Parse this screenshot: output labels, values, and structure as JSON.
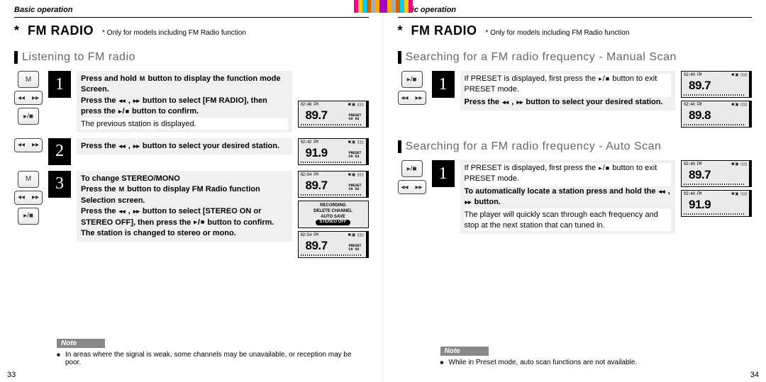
{
  "header": "Basic operation",
  "feature": {
    "asterisk": "*",
    "title": "FM RADIO",
    "subtitle": "* Only for models including FM Radio function"
  },
  "left": {
    "section1": "Listening to FM radio",
    "step1": {
      "num": "1",
      "text_a": "Press and hold ",
      "btn_m": "M",
      "text_b": " button to display the function mode Screen.",
      "text_c": "Press the ",
      "text_d": " button to select [FM RADIO], then press the ",
      "text_e": " button to confirm.",
      "subtext": "The previous station is displayed.",
      "lcd": {
        "time": "02:40 FM",
        "bat": "■■■■",
        "freq": "89.7",
        "preset": "PRESET",
        "ch": "CH 02"
      }
    },
    "step2": {
      "num": "2",
      "text_a": "Press the ",
      "text_b": " button to select your desired station.",
      "lcd": {
        "time": "02:42 FM",
        "freq": "91.9",
        "preset": "PRESET",
        "ch": "CH 03"
      }
    },
    "step3": {
      "num": "3",
      "title": "To change STEREO/MONO",
      "text_a": "Press the ",
      "btn_m": "M",
      "text_b": " button to display FM Radio function Selection screen.",
      "text_c": "Press the ",
      "text_d": " button to select [STEREO ON or STEREO OFF], then press the ",
      "text_e": " button to confirm.",
      "text_f": "The station is changed to stereo or mono.",
      "lcd1": {
        "time": "02:54 FM",
        "freq": "89.7",
        "preset": "PRESET",
        "ch": "CH 02"
      },
      "menu": {
        "l1": "RECORDING",
        "l2": "DELETE CHANNEL",
        "l3": "AUTO SAVE",
        "sel": "STEREO OFF"
      },
      "lcd2": {
        "time": "02:54 FM",
        "freq": "89.7",
        "preset": "PRESET",
        "ch": "CH 02"
      }
    },
    "note": "In areas where the signal is weak, some channels may be unavailable, or reception may be poor.",
    "page_num": "33"
  },
  "right": {
    "section1": "Searching for a FM radio frequency - Manual Scan",
    "step1": {
      "num": "1",
      "text_a": "If PRESET is displayed, first press the ",
      "text_b": " button to exit PRESET mode.",
      "text_c": "Press the ",
      "text_d": " button to select your desired station.",
      "lcd1": {
        "time": "02:40 FM",
        "freq": "89.7"
      },
      "lcd2": {
        "time": "02:40 FM",
        "freq": "89.8"
      }
    },
    "section2": "Searching for a FM radio frequency - Auto Scan",
    "step2": {
      "num": "1",
      "text_a": "If PRESET is displayed, first press the ",
      "text_b": " button to exit PRESET mode.",
      "text_c": "To automatically locate a station press and hold the ",
      "text_d": " button.",
      "subtext": "The player will quickly scan through each frequency and stop at the next station that can tuned in.",
      "lcd1": {
        "time": "02:40 FM",
        "freq": "89.7"
      },
      "lcd2": {
        "time": "02:40 FM",
        "freq": "91.9"
      }
    },
    "note": "While in Preset mode, auto scan functions are not available.",
    "page_num": "34"
  },
  "labels": {
    "note": "Note"
  },
  "icons": {
    "rew": "◂◂",
    "fwd": "▸▸",
    "play": "▸",
    "stop": "■",
    "sep": "/",
    "comma": " , "
  }
}
